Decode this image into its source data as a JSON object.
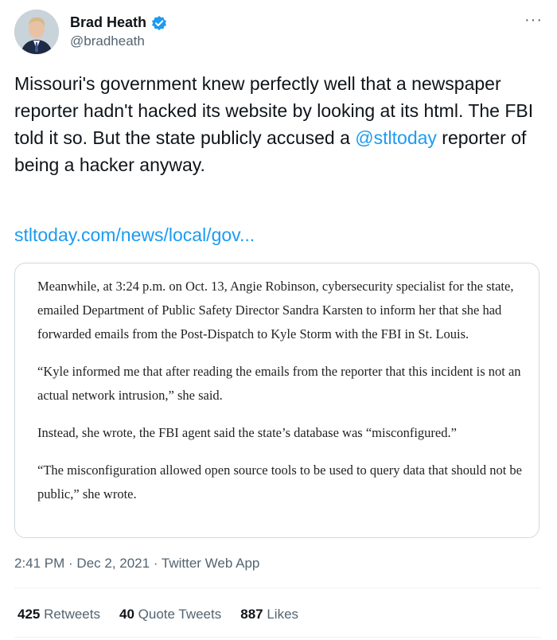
{
  "author": {
    "name": "Brad Heath",
    "handle": "@bradheath",
    "verified": true
  },
  "more_icon": "more-horizontal-icon",
  "tweet": {
    "text_before": "Missouri's government knew perfectly well that a newspaper reporter hadn't hacked its website by looking at its html. The FBI told it so. But the state publicly accused a ",
    "mention": "@stltoday",
    "text_after": " reporter of being a hacker anyway.",
    "link": "stltoday.com/news/local/gov..."
  },
  "card": {
    "paragraphs": [
      "Meanwhile, at 3:24 p.m. on Oct. 13, Angie Robinson, cybersecurity specialist for the state, emailed Department of Public Safety Director Sandra Karsten to inform her that she had forwarded emails from the Post-Dispatch to Kyle Storm with the FBI in St. Louis.",
      "“Kyle informed me that after reading the emails from the reporter that this incident is not an actual network intrusion,” she said.",
      "Instead, she wrote, the FBI agent said the state’s database was “misconfigured.”",
      "“The misconfiguration allowed open source tools to be used to query data that should not be public,” she wrote."
    ]
  },
  "timestamp": "2:41 PM · Dec 2, 2021 · Twitter Web App",
  "stats": {
    "retweets_count": "425",
    "retweets_label": "Retweets",
    "quotes_count": "40",
    "quotes_label": "Quote Tweets",
    "likes_count": "887",
    "likes_label": "Likes"
  },
  "colors": {
    "accent": "#1d9bf0",
    "secondary_text": "#536471",
    "border": "#cfd9de"
  }
}
